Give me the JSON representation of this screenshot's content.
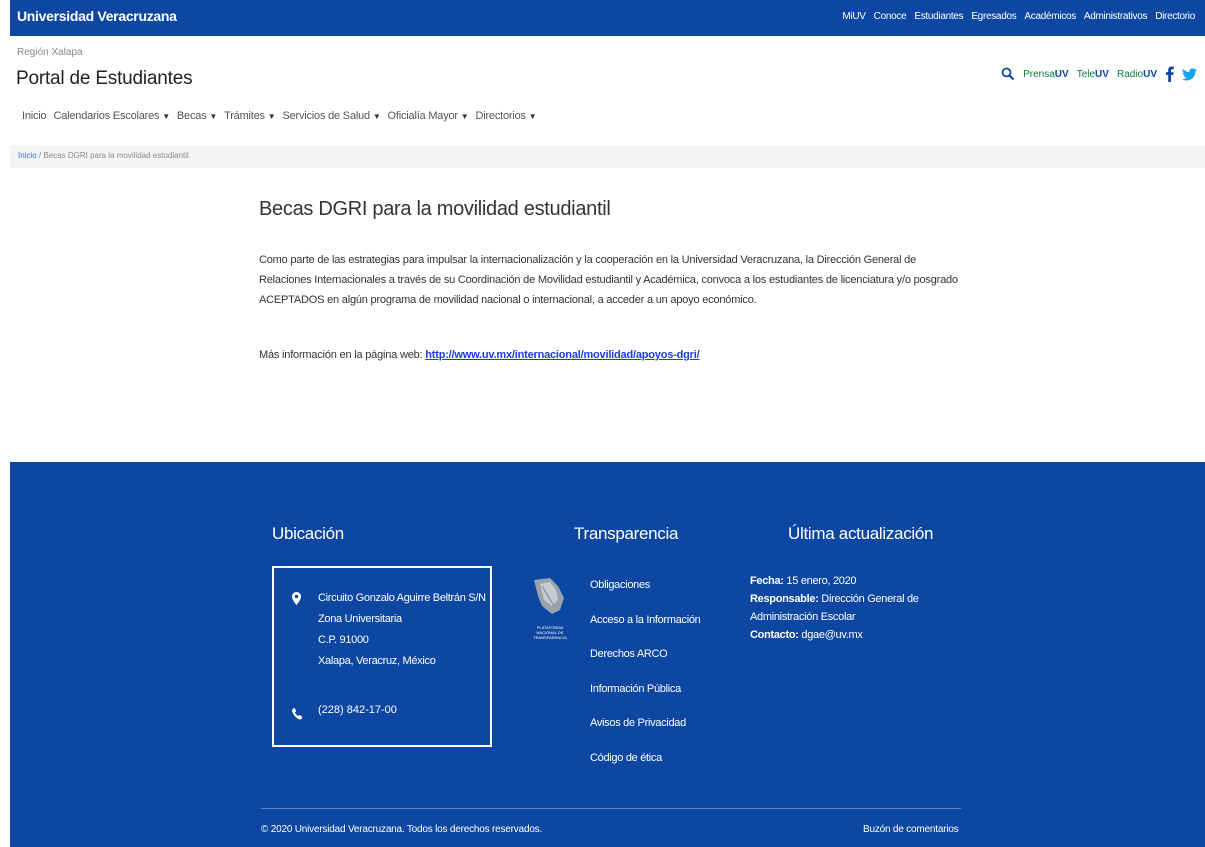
{
  "topbar": {
    "brand": "Universidad Veracruzana",
    "links": [
      "MiUV",
      "Conoce",
      "Estudiantes",
      "Egresados",
      "Académicos",
      "Administrativos",
      "Directorio"
    ]
  },
  "header": {
    "region": "Región Xalapa",
    "portal_title": "Portal de Estudiantes",
    "prensa": "Prensa",
    "tele": "Tele",
    "radio": "Radio",
    "uv": "UV"
  },
  "nav": [
    "Inicio",
    "Calendarios Escolares",
    "Becas",
    "Trámites",
    "Servicios de Salud",
    "Oficialía Mayor",
    "Directorios"
  ],
  "breadcrumb": {
    "home": "Inicio",
    "separator": "/",
    "current": "Becas DGRI para la movilidad estudiantil"
  },
  "main": {
    "title": "Becas DGRI para la movilidad estudiantil",
    "paragraph": "Como parte de las estrategias para impulsar la internacionalización y la cooperación en la Universidad Veracruzana, la Dirección General de Relaciones Internacionales a través de su Coordinación de Movilidad estudiantil y Académica, convoca a los estudiantes de licenciatura y/o posgrado ACEPTADOS en algún programa de movilidad nacional o internacional, a acceder a un apoyo económico.",
    "more_info_label": "Más información en la página web:",
    "more_info_link": "http://www.uv.mx/internacional/movilidad/apoyos-dgri/"
  },
  "footer": {
    "ubicacion_title": "Ubicación",
    "address": [
      "Circuito Gonzalo Aguirre Beltrán S/N",
      "Zona Universitaria",
      "C.P. 91000",
      "Xalapa, Veracruz, México"
    ],
    "phone": "(228) 842-17-00",
    "transparencia_title": "Transparencia",
    "pnt_label": "PLATAFORMA NACIONAL DE TRANSPARENCIA",
    "transparencia_links": [
      "Obligaciones",
      "Acceso a la Información",
      "Derechos ARCO",
      "Información Pública",
      "Avisos de Privacidad",
      "Código de ética"
    ],
    "update_title": "Última actualización",
    "fecha_label": "Fecha:",
    "fecha_value": "15 enero, 2020",
    "responsable_label": "Responsable:",
    "responsable_value": "Dirección General de Administración Escolar",
    "contacto_label": "Contacto:",
    "contacto_value": "dgae@uv.mx",
    "copyright": "© 2020 Universidad Veracruzana. Todos los derechos reservados.",
    "buzon": "Buzón de comentarios"
  },
  "colors": {
    "brand_blue": "#0d47a1",
    "link_blue": "#1a3fd6",
    "uv_green": "#0d7a3c",
    "twitter": "#1da1f2"
  },
  "icons": [
    "search-icon",
    "facebook-icon",
    "twitter-icon",
    "map-pin-icon",
    "phone-icon",
    "pnt-logo",
    "caret-down-icon"
  ]
}
